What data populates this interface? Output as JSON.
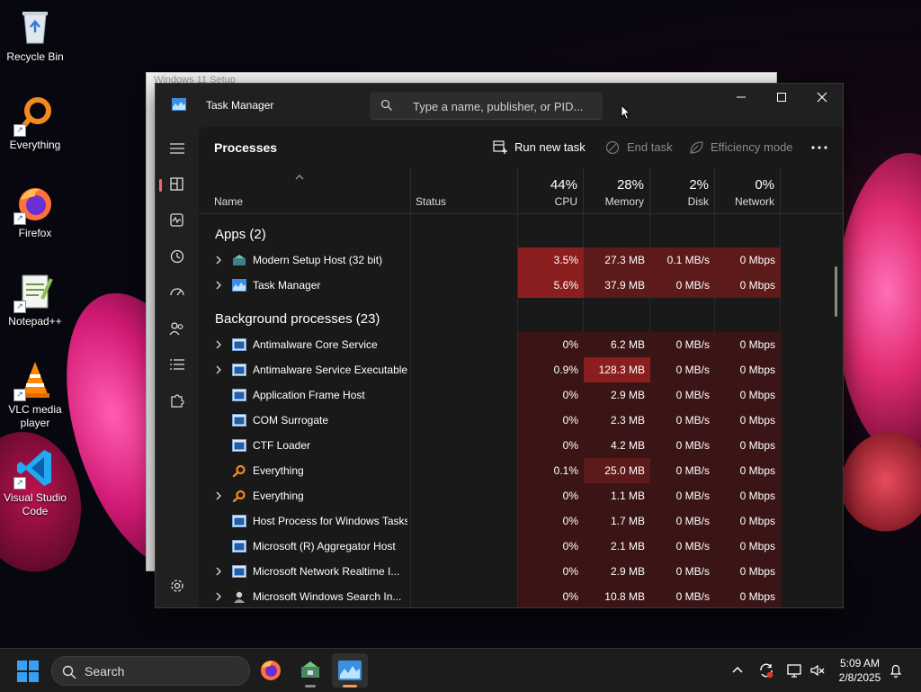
{
  "desktop": {
    "icons": [
      {
        "label": "Recycle Bin"
      },
      {
        "label": "Everything"
      },
      {
        "label": "Firefox"
      },
      {
        "label": "Notepad++"
      },
      {
        "label": "VLC media player"
      },
      {
        "label": "Visual Studio Code"
      }
    ],
    "behind_window_title": "Windows 11 Setup"
  },
  "task_manager": {
    "title": "Task Manager",
    "search_placeholder": "Type a name, publisher, or PID...",
    "page_title": "Processes",
    "toolbar": {
      "run_new_task": "Run new task",
      "end_task": "End task",
      "efficiency_mode": "Efficiency mode"
    },
    "columns": {
      "name": "Name",
      "status": "Status",
      "cpu": {
        "pct": "44%",
        "label": "CPU"
      },
      "memory": {
        "pct": "28%",
        "label": "Memory"
      },
      "disk": {
        "pct": "2%",
        "label": "Disk"
      },
      "network": {
        "pct": "0%",
        "label": "Network"
      }
    },
    "sections": {
      "apps": "Apps (2)",
      "background": "Background processes (23)"
    },
    "apps": [
      {
        "name": "Modern Setup Host (32 bit)",
        "cpu": "3.5%",
        "memory": "27.3 MB",
        "disk": "0.1 MB/s",
        "network": "0 Mbps",
        "expandable": true,
        "icon": "setup-host-icon"
      },
      {
        "name": "Task Manager",
        "cpu": "5.6%",
        "memory": "37.9 MB",
        "disk": "0 MB/s",
        "network": "0 Mbps",
        "expandable": true,
        "icon": "task-manager-icon"
      }
    ],
    "background": [
      {
        "name": "Antimalware Core Service",
        "cpu": "0%",
        "memory": "6.2 MB",
        "disk": "0 MB/s",
        "network": "0 Mbps",
        "expandable": true,
        "icon": "service-icon"
      },
      {
        "name": "Antimalware Service Executable",
        "cpu": "0.9%",
        "memory": "128.3 MB",
        "disk": "0 MB/s",
        "network": "0 Mbps",
        "expandable": true,
        "icon": "service-icon"
      },
      {
        "name": "Application Frame Host",
        "cpu": "0%",
        "memory": "2.9 MB",
        "disk": "0 MB/s",
        "network": "0 Mbps",
        "expandable": false,
        "icon": "service-icon"
      },
      {
        "name": "COM Surrogate",
        "cpu": "0%",
        "memory": "2.3 MB",
        "disk": "0 MB/s",
        "network": "0 Mbps",
        "expandable": false,
        "icon": "service-icon"
      },
      {
        "name": "CTF Loader",
        "cpu": "0%",
        "memory": "4.2 MB",
        "disk": "0 MB/s",
        "network": "0 Mbps",
        "expandable": false,
        "icon": "service-icon"
      },
      {
        "name": "Everything",
        "cpu": "0.1%",
        "memory": "25.0 MB",
        "disk": "0 MB/s",
        "network": "0 Mbps",
        "expandable": false,
        "icon": "everything-icon"
      },
      {
        "name": "Everything",
        "cpu": "0%",
        "memory": "1.1 MB",
        "disk": "0 MB/s",
        "network": "0 Mbps",
        "expandable": true,
        "icon": "everything-icon"
      },
      {
        "name": "Host Process for Windows Tasks",
        "cpu": "0%",
        "memory": "1.7 MB",
        "disk": "0 MB/s",
        "network": "0 Mbps",
        "expandable": false,
        "icon": "service-icon"
      },
      {
        "name": "Microsoft (R) Aggregator Host",
        "cpu": "0%",
        "memory": "2.1 MB",
        "disk": "0 MB/s",
        "network": "0 Mbps",
        "expandable": false,
        "icon": "service-icon"
      },
      {
        "name": "Microsoft Network Realtime I...",
        "cpu": "0%",
        "memory": "2.9 MB",
        "disk": "0 MB/s",
        "network": "0 Mbps",
        "expandable": true,
        "icon": "service-icon"
      },
      {
        "name": "Microsoft Windows Search In...",
        "cpu": "0%",
        "memory": "10.8 MB",
        "disk": "0 MB/s",
        "network": "0 Mbps",
        "expandable": true,
        "icon": "search-indexer-icon"
      }
    ],
    "heat_colors": {
      "low": "#3b1515",
      "mid": "#5c1a1a",
      "high": "#8b1e1e"
    }
  },
  "taskbar": {
    "search_label": "Search",
    "time": "5:09 AM",
    "date": "2/8/2025"
  }
}
